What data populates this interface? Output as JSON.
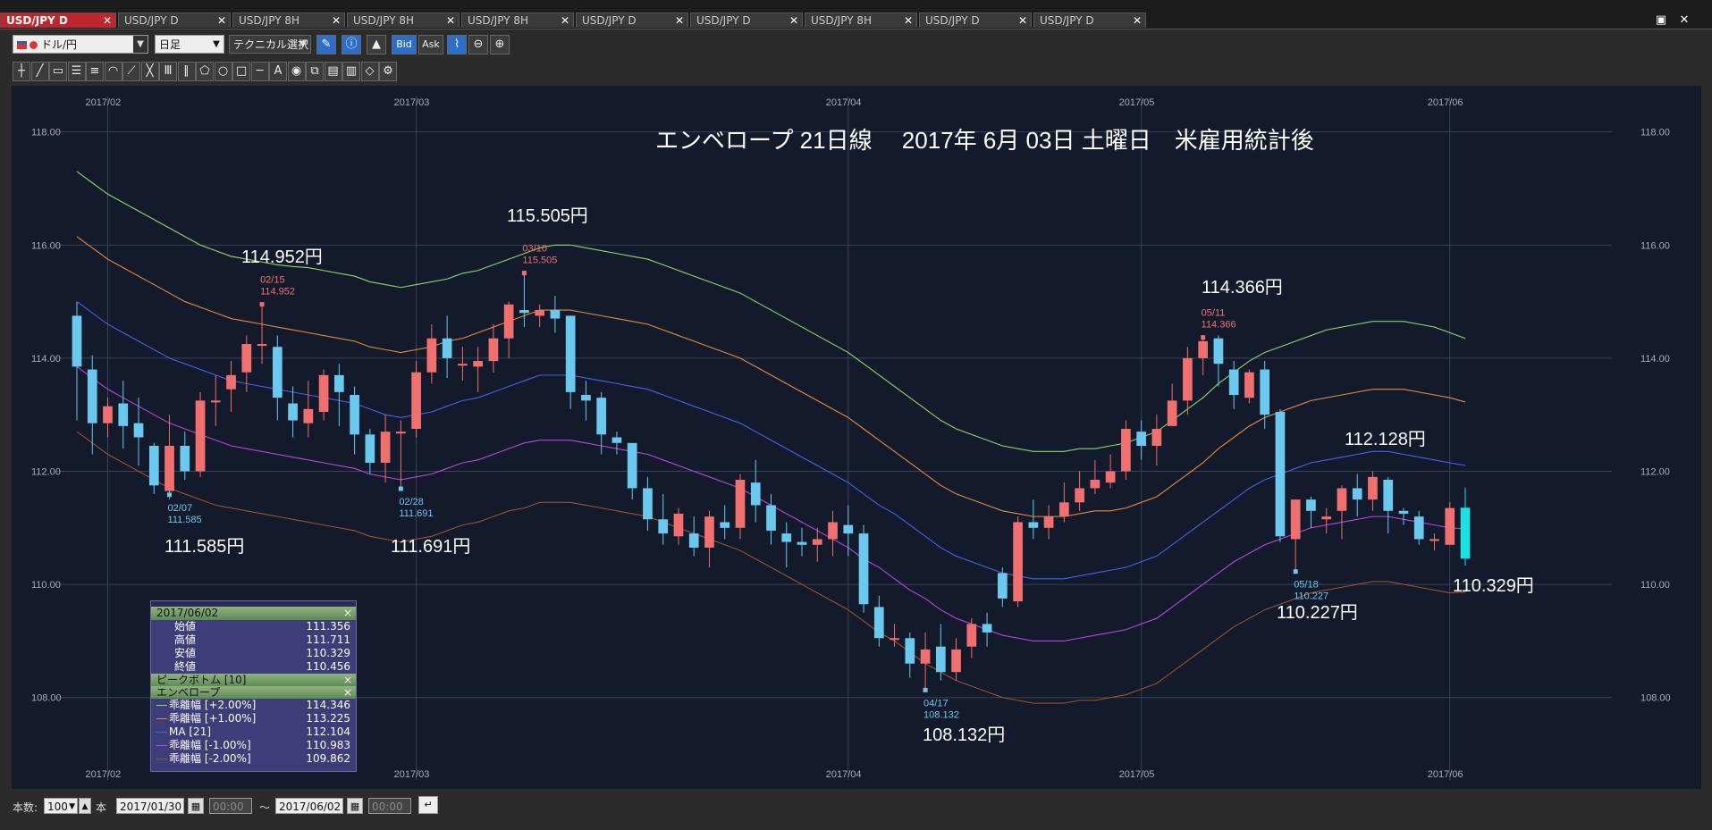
{
  "tabs": [
    {
      "label": "USD/JPY D",
      "active": true
    },
    {
      "label": "USD/JPY D",
      "active": false
    },
    {
      "label": "USD/JPY 8H",
      "active": false
    },
    {
      "label": "USD/JPY 8H",
      "active": false
    },
    {
      "label": "USD/JPY 8H",
      "active": false
    },
    {
      "label": "USD/JPY D",
      "active": false
    },
    {
      "label": "USD/JPY D",
      "active": false
    },
    {
      "label": "USD/JPY 8H",
      "active": false
    },
    {
      "label": "USD/JPY D",
      "active": false
    },
    {
      "label": "USD/JPY D",
      "active": false
    }
  ],
  "toolbar": {
    "symbol": "ドル/円",
    "period": "日足",
    "technical": "テクニカル選択",
    "bid_label": "Bid",
    "ask_label": "Ask"
  },
  "drawing_tools": [
    "crosshair-icon",
    "trendline-icon",
    "ruler-icon",
    "horizontal-lines-icon",
    "channel-icon",
    "fan-icon",
    "pitchfork-icon",
    "gann-icon",
    "fibonacci-icon",
    "parallel-icon",
    "pentagon-icon",
    "circle-icon",
    "rectangle-icon",
    "hline-icon",
    "text-icon",
    "label-icon",
    "copy-icon",
    "layers-icon",
    "save-icon",
    "eraser-icon",
    "settings-icon"
  ],
  "bottom": {
    "count_label": "本数:",
    "count_value": "100",
    "count_unit": "本",
    "from_date": "2017/01/30",
    "from_time": "00:00",
    "tilde": "〜",
    "to_date": "2017/06/02",
    "to_time": "00:00"
  },
  "info_panel": {
    "date": "2017/06/02",
    "rows": [
      {
        "label": "始値",
        "value": "111.356"
      },
      {
        "label": "高値",
        "value": "111.711"
      },
      {
        "label": "安値",
        "value": "110.329"
      },
      {
        "label": "終値",
        "value": "110.456"
      }
    ],
    "section1": "ピークボトム [10]",
    "section2": "エンベロープ",
    "env_rows": [
      {
        "label": "乖離幅 [+2.00%]",
        "value": "114.346",
        "color": "#8fd66a"
      },
      {
        "label": "乖離幅 [+1.00%]",
        "value": "113.225",
        "color": "#e8893a"
      },
      {
        "label": "MA [21]",
        "value": "112.104",
        "color": "#4a5fe8"
      },
      {
        "label": "乖離幅 [-1.00%]",
        "value": "110.983",
        "color": "#b845e0"
      },
      {
        "label": "乖離幅 [-2.00%]",
        "value": "109.862",
        "color": "#9a5230"
      }
    ]
  },
  "chart_data": {
    "type": "candlestick",
    "title": "エンベロープ 21日線　 2017年 6月 03日 土曜日　米雇用統計後",
    "y_ticks": [
      "118.00",
      "116.00",
      "114.00",
      "112.00",
      "110.00",
      "108.00"
    ],
    "ylim": [
      106.7,
      118.5
    ],
    "x_month_labels": [
      "2017/02",
      "2017/03",
      "2017/04",
      "2017/05",
      "2017/06"
    ],
    "colors": {
      "up": "#f07070",
      "down": "#6bc8ee",
      "last": "#1de0e0"
    },
    "candles": [
      [
        114.75,
        113.85,
        115.0,
        112.9
      ],
      [
        113.8,
        112.85,
        114.05,
        112.3
      ],
      [
        112.85,
        113.15,
        113.3,
        112.6
      ],
      [
        113.2,
        112.8,
        113.6,
        112.4
      ],
      [
        112.85,
        112.6,
        113.3,
        112.1
      ],
      [
        112.45,
        111.75,
        112.5,
        111.6
      ],
      [
        111.65,
        112.45,
        113.0,
        111.5
      ],
      [
        112.45,
        112.0,
        112.7,
        111.85
      ],
      [
        112.0,
        113.25,
        113.4,
        111.9
      ],
      [
        113.25,
        113.25,
        113.7,
        112.8
      ],
      [
        113.45,
        113.7,
        113.95,
        113.05
      ],
      [
        113.75,
        114.25,
        114.4,
        113.4
      ],
      [
        114.25,
        114.25,
        114.95,
        113.9
      ],
      [
        114.2,
        113.3,
        114.4,
        112.9
      ],
      [
        113.2,
        112.9,
        113.5,
        112.6
      ],
      [
        112.85,
        113.1,
        113.6,
        112.6
      ],
      [
        113.05,
        113.7,
        113.8,
        112.9
      ],
      [
        113.7,
        113.4,
        113.9,
        112.8
      ],
      [
        113.35,
        112.65,
        113.5,
        112.3
      ],
      [
        112.65,
        112.15,
        112.75,
        111.95
      ],
      [
        112.15,
        112.7,
        113.0,
        111.8
      ],
      [
        112.7,
        112.7,
        112.9,
        111.69
      ],
      [
        112.75,
        113.75,
        113.95,
        112.6
      ],
      [
        113.75,
        114.35,
        114.6,
        113.55
      ],
      [
        114.35,
        114.0,
        114.75,
        113.65
      ],
      [
        113.9,
        113.9,
        114.2,
        113.6
      ],
      [
        113.85,
        113.95,
        114.2,
        113.4
      ],
      [
        113.95,
        114.35,
        114.6,
        113.75
      ],
      [
        114.35,
        114.95,
        115.0,
        114.0
      ],
      [
        114.85,
        114.8,
        115.505,
        114.55
      ],
      [
        114.75,
        114.85,
        114.95,
        114.55
      ],
      [
        114.85,
        114.7,
        115.1,
        114.45
      ],
      [
        114.75,
        113.4,
        114.75,
        113.1
      ],
      [
        113.35,
        113.25,
        113.6,
        112.9
      ],
      [
        113.3,
        112.65,
        113.4,
        112.3
      ],
      [
        112.6,
        112.5,
        112.7,
        112.3
      ],
      [
        112.5,
        111.7,
        112.5,
        111.5
      ],
      [
        111.7,
        111.15,
        111.9,
        110.95
      ],
      [
        111.15,
        110.9,
        111.6,
        110.7
      ],
      [
        110.85,
        111.25,
        111.35,
        110.7
      ],
      [
        110.9,
        110.65,
        111.2,
        110.5
      ],
      [
        110.65,
        111.2,
        111.3,
        110.3
      ],
      [
        111.1,
        111.0,
        111.4,
        110.8
      ],
      [
        111.0,
        111.85,
        111.95,
        110.8
      ],
      [
        111.8,
        111.4,
        112.2,
        111.1
      ],
      [
        111.4,
        110.95,
        111.6,
        110.7
      ],
      [
        110.9,
        110.75,
        111.1,
        110.3
      ],
      [
        110.75,
        110.7,
        111.0,
        110.5
      ],
      [
        110.7,
        110.8,
        111.0,
        110.4
      ],
      [
        110.8,
        111.1,
        111.3,
        110.5
      ],
      [
        111.05,
        110.9,
        111.4,
        110.5
      ],
      [
        110.9,
        109.65,
        111.05,
        109.5
      ],
      [
        109.6,
        109.05,
        109.8,
        108.9
      ],
      [
        109.05,
        109.05,
        109.3,
        108.9
      ],
      [
        109.05,
        108.6,
        109.15,
        108.35
      ],
      [
        108.6,
        108.85,
        109.15,
        108.132
      ],
      [
        108.9,
        108.45,
        109.3,
        108.3
      ],
      [
        108.45,
        108.85,
        109.05,
        108.3
      ],
      [
        108.9,
        109.3,
        109.4,
        108.7
      ],
      [
        109.3,
        109.15,
        109.5,
        108.9
      ],
      [
        110.2,
        109.75,
        110.3,
        109.6
      ],
      [
        109.7,
        111.1,
        111.2,
        109.6
      ],
      [
        111.1,
        111.0,
        111.5,
        110.8
      ],
      [
        111.0,
        111.2,
        111.4,
        110.8
      ],
      [
        111.2,
        111.45,
        111.8,
        111.1
      ],
      [
        111.45,
        111.7,
        112.0,
        111.3
      ],
      [
        111.7,
        111.85,
        112.2,
        111.6
      ],
      [
        111.8,
        112.0,
        112.3,
        111.7
      ],
      [
        112.0,
        112.75,
        112.9,
        111.85
      ],
      [
        112.7,
        112.45,
        112.9,
        112.2
      ],
      [
        112.45,
        112.75,
        113.0,
        112.1
      ],
      [
        112.8,
        113.25,
        113.55,
        112.9
      ],
      [
        113.25,
        114.0,
        114.2,
        113.0
      ],
      [
        114.0,
        114.3,
        114.366,
        113.7
      ],
      [
        114.35,
        113.9,
        114.4,
        113.5
      ],
      [
        113.8,
        113.35,
        113.95,
        113.1
      ],
      [
        113.3,
        113.75,
        113.8,
        113.2
      ],
      [
        113.8,
        113.0,
        113.95,
        112.75
      ],
      [
        113.05,
        110.85,
        113.1,
        110.75
      ],
      [
        110.8,
        111.5,
        111.5,
        110.227
      ],
      [
        111.5,
        111.3,
        111.55,
        111.0
      ],
      [
        111.15,
        111.2,
        111.35,
        110.9
      ],
      [
        111.3,
        111.7,
        111.75,
        110.8
      ],
      [
        111.7,
        111.5,
        111.95,
        111.2
      ],
      [
        111.5,
        111.9,
        112.0,
        111.3
      ],
      [
        111.85,
        111.3,
        111.9,
        110.9
      ],
      [
        111.3,
        111.25,
        111.35,
        111.05
      ],
      [
        111.2,
        110.8,
        111.3,
        110.7
      ],
      [
        110.8,
        110.8,
        110.9,
        110.6
      ],
      [
        110.7,
        111.35,
        111.45,
        110.7
      ],
      [
        111.356,
        110.456,
        111.711,
        110.329
      ]
    ],
    "series": [
      {
        "name": "乖離幅 [+2.00%]",
        "color": "#8fd66a",
        "values": [
          117.3,
          117.1,
          116.9,
          116.75,
          116.6,
          116.45,
          116.3,
          116.15,
          116.0,
          115.9,
          115.8,
          115.75,
          115.7,
          115.65,
          115.62,
          115.6,
          115.55,
          115.5,
          115.45,
          115.35,
          115.3,
          115.25,
          115.3,
          115.35,
          115.4,
          115.5,
          115.55,
          115.65,
          115.75,
          115.85,
          115.95,
          116.0,
          116.0,
          115.95,
          115.9,
          115.85,
          115.8,
          115.75,
          115.65,
          115.55,
          115.45,
          115.35,
          115.25,
          115.15,
          115.0,
          114.85,
          114.7,
          114.55,
          114.4,
          114.25,
          114.1,
          113.9,
          113.7,
          113.5,
          113.3,
          113.1,
          112.9,
          112.75,
          112.65,
          112.55,
          112.45,
          112.4,
          112.35,
          112.35,
          112.35,
          112.4,
          112.4,
          112.45,
          112.5,
          112.6,
          112.7,
          112.9,
          113.1,
          113.3,
          113.55,
          113.75,
          113.95,
          114.1,
          114.2,
          114.3,
          114.4,
          114.5,
          114.55,
          114.6,
          114.65,
          114.65,
          114.65,
          114.6,
          114.55,
          114.45,
          114.35
        ]
      },
      {
        "name": "乖離幅 [+1.00%]",
        "color": "#e8893a",
        "values": [
          116.15,
          115.95,
          115.75,
          115.6,
          115.45,
          115.3,
          115.15,
          115.0,
          114.9,
          114.8,
          114.7,
          114.65,
          114.6,
          114.55,
          114.5,
          114.45,
          114.4,
          114.35,
          114.3,
          114.2,
          114.15,
          114.1,
          114.15,
          114.2,
          114.3,
          114.35,
          114.45,
          114.55,
          114.65,
          114.75,
          114.85,
          114.85,
          114.85,
          114.8,
          114.75,
          114.7,
          114.65,
          114.6,
          114.5,
          114.4,
          114.3,
          114.2,
          114.1,
          114.0,
          113.85,
          113.7,
          113.55,
          113.4,
          113.25,
          113.1,
          112.95,
          112.75,
          112.55,
          112.35,
          112.15,
          111.95,
          111.75,
          111.6,
          111.5,
          111.4,
          111.3,
          111.25,
          111.2,
          111.2,
          111.2,
          111.25,
          111.3,
          111.3,
          111.35,
          111.45,
          111.55,
          111.75,
          111.95,
          112.15,
          112.4,
          112.6,
          112.8,
          112.95,
          113.05,
          113.15,
          113.25,
          113.3,
          113.35,
          113.4,
          113.45,
          113.45,
          113.45,
          113.4,
          113.35,
          113.3,
          113.225
        ]
      },
      {
        "name": "MA [21]",
        "color": "#4a5fe8",
        "values": [
          115.0,
          114.8,
          114.6,
          114.45,
          114.3,
          114.15,
          114.0,
          113.9,
          113.8,
          113.7,
          113.6,
          113.55,
          113.5,
          113.45,
          113.4,
          113.35,
          113.3,
          113.25,
          113.2,
          113.1,
          113.0,
          112.95,
          113.0,
          113.05,
          113.15,
          113.25,
          113.3,
          113.4,
          113.5,
          113.6,
          113.7,
          113.7,
          113.7,
          113.65,
          113.6,
          113.55,
          113.5,
          113.45,
          113.35,
          113.25,
          113.15,
          113.05,
          112.95,
          112.85,
          112.7,
          112.55,
          112.4,
          112.25,
          112.1,
          111.95,
          111.8,
          111.6,
          111.4,
          111.25,
          111.05,
          110.85,
          110.65,
          110.5,
          110.4,
          110.3,
          110.2,
          110.15,
          110.1,
          110.1,
          110.1,
          110.15,
          110.2,
          110.25,
          110.3,
          110.4,
          110.5,
          110.7,
          110.9,
          111.1,
          111.3,
          111.5,
          111.7,
          111.85,
          111.95,
          112.05,
          112.15,
          112.2,
          112.25,
          112.3,
          112.35,
          112.35,
          112.3,
          112.25,
          112.2,
          112.15,
          112.104
        ]
      },
      {
        "name": "乖離幅 [-1.00%]",
        "color": "#b845e0",
        "values": [
          113.85,
          113.65,
          113.45,
          113.3,
          113.15,
          113.0,
          112.85,
          112.75,
          112.65,
          112.55,
          112.45,
          112.4,
          112.35,
          112.3,
          112.25,
          112.2,
          112.15,
          112.1,
          112.05,
          111.95,
          111.9,
          111.85,
          111.9,
          111.95,
          112.05,
          112.15,
          112.2,
          112.3,
          112.4,
          112.5,
          112.55,
          112.55,
          112.55,
          112.5,
          112.45,
          112.4,
          112.35,
          112.3,
          112.2,
          112.1,
          112.0,
          111.9,
          111.8,
          111.7,
          111.55,
          111.4,
          111.25,
          111.1,
          110.95,
          110.8,
          110.65,
          110.45,
          110.3,
          110.1,
          109.9,
          109.75,
          109.55,
          109.4,
          109.3,
          109.2,
          109.1,
          109.05,
          109.0,
          109.0,
          109.0,
          109.05,
          109.1,
          109.15,
          109.2,
          109.3,
          109.4,
          109.6,
          109.8,
          110.0,
          110.2,
          110.4,
          110.55,
          110.7,
          110.8,
          110.9,
          111.0,
          111.05,
          111.1,
          111.15,
          111.2,
          111.2,
          111.15,
          111.1,
          111.05,
          111.0,
          110.983
        ]
      },
      {
        "name": "乖離幅 [-2.00%]",
        "color": "#9a5230",
        "values": [
          112.7,
          112.5,
          112.3,
          112.15,
          112.0,
          111.85,
          111.7,
          111.6,
          111.5,
          111.4,
          111.35,
          111.3,
          111.25,
          111.2,
          111.15,
          111.1,
          111.05,
          111.0,
          110.95,
          110.85,
          110.8,
          110.75,
          110.8,
          110.85,
          110.95,
          111.05,
          111.1,
          111.2,
          111.3,
          111.35,
          111.45,
          111.45,
          111.45,
          111.4,
          111.35,
          111.3,
          111.25,
          111.2,
          111.1,
          111.0,
          110.9,
          110.8,
          110.7,
          110.6,
          110.45,
          110.3,
          110.15,
          110.0,
          109.85,
          109.7,
          109.55,
          109.35,
          109.15,
          109.0,
          108.8,
          108.6,
          108.45,
          108.3,
          108.2,
          108.1,
          108.0,
          107.95,
          107.9,
          107.9,
          107.9,
          107.95,
          107.95,
          108.0,
          108.05,
          108.15,
          108.25,
          108.45,
          108.65,
          108.85,
          109.05,
          109.25,
          109.4,
          109.55,
          109.65,
          109.75,
          109.85,
          109.9,
          109.95,
          110.0,
          110.05,
          110.05,
          110.0,
          109.95,
          109.9,
          109.85,
          109.862
        ]
      }
    ],
    "peak_labels": [
      {
        "date": "02/15",
        "value": "114.952",
        "kind": "peak"
      },
      {
        "date": "03/10",
        "value": "115.505",
        "kind": "peak"
      },
      {
        "date": "05/11",
        "value": "114.366",
        "kind": "peak"
      },
      {
        "date": "02/07",
        "value": "111.585",
        "kind": "bottom"
      },
      {
        "date": "02/28",
        "value": "111.691",
        "kind": "bottom"
      },
      {
        "date": "04/17",
        "value": "108.132",
        "kind": "bottom"
      },
      {
        "date": "05/18",
        "value": "110.227",
        "kind": "bottom"
      }
    ],
    "annotations": [
      "114.952円",
      "115.505円",
      "114.366円",
      "111.585円",
      "111.691円",
      "108.132円",
      "110.227円",
      "112.128円",
      "110.329円"
    ]
  }
}
